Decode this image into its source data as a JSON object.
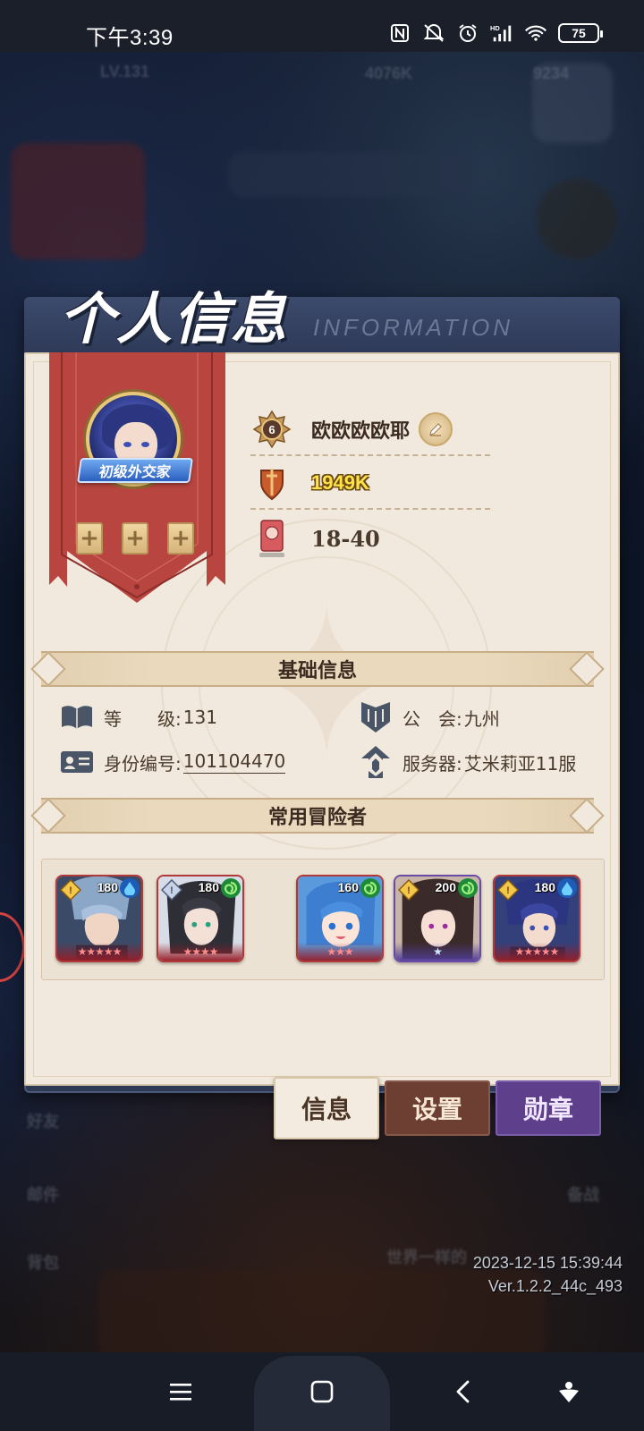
{
  "status_bar": {
    "time": "下午3:39",
    "battery": "75",
    "icons": [
      "nfc-icon",
      "mute-icon",
      "alarm-icon",
      "signal-icon",
      "wifi-icon",
      "battery-icon"
    ]
  },
  "background": {
    "level_text": "LV.131",
    "stat_a": "4076K",
    "stat_b": "9234",
    "left_menu": [
      "好友",
      "邮件",
      "背包"
    ],
    "right_label": "备战",
    "bottom_text": "世界一样的"
  },
  "panel": {
    "title": "个人信息",
    "subtitle": "INFORMATION"
  },
  "profile": {
    "title_badge": "初级外交家",
    "slots": [
      "+",
      "+",
      "+"
    ],
    "rank_level": "6",
    "player_name": "欧欧欧欧耶",
    "power": "1949K",
    "stage": "18-40"
  },
  "basic_info": {
    "header": "基础信息",
    "level_label": "等　　级:",
    "level_value": "131",
    "guild_label": "公　会:",
    "guild_value": "九州",
    "id_label": "身份编号:",
    "id_value": "101104470",
    "server_label": "服务器:",
    "server_value": "艾米莉亚11服"
  },
  "adventurers": {
    "header": "常用冒险者",
    "heroes": [
      {
        "level": "180",
        "element": "water",
        "stars": 5,
        "frame": "red"
      },
      {
        "level": "180",
        "element": "wind",
        "stars": 4,
        "frame": "red"
      },
      {
        "level": "160",
        "element": "wind",
        "stars": 3,
        "frame": "red"
      },
      {
        "level": "200",
        "element": "wind",
        "stars": 1,
        "frame": "purple"
      },
      {
        "level": "180",
        "element": "water",
        "stars": 5,
        "frame": "red"
      }
    ]
  },
  "tabs": {
    "info": "信息",
    "settings": "设置",
    "medal": "勋章"
  },
  "footer": {
    "timestamp": "2023-12-15 15:39:44",
    "version": "Ver.1.2.2_44c_493"
  },
  "colors": {
    "panel_bg": "#f1e9dd",
    "banner_red": "#b8453f",
    "power_yellow": "#ffe24a",
    "tab_settings": "#6d3f33",
    "tab_medal": "#5d3f8b"
  }
}
